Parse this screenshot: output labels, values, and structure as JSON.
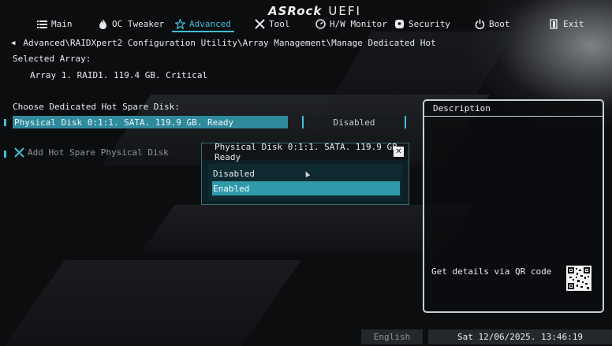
{
  "brand": {
    "logo": "ASRock",
    "product": "UEFI"
  },
  "menu": [
    {
      "label": "Main",
      "icon": "list-icon"
    },
    {
      "label": "OC Tweaker",
      "icon": "flame-icon"
    },
    {
      "label": "Advanced",
      "icon": "star-icon",
      "active": true
    },
    {
      "label": "Tool",
      "icon": "tools-icon"
    },
    {
      "label": "H/W Monitor",
      "icon": "monitor-icon"
    },
    {
      "label": "Security",
      "icon": "shield-icon"
    },
    {
      "label": "Boot",
      "icon": "power-icon"
    },
    {
      "label": "Exit",
      "icon": "exit-icon"
    }
  ],
  "breadcrumb": "Advanced\\RAIDXpert2 Configuration Utility\\Array Management\\Manage Dedicated Hot",
  "selected_array": {
    "label": "Selected Array:",
    "value": "Array 1. RAID1. 119.4 GB. Critical"
  },
  "choose_label": "Choose Dedicated Hot Spare Disk:",
  "disk_row": {
    "label": "Physical Disk 0:1:1. SATA. 119.9 GB. Ready",
    "value": "Disabled"
  },
  "add_hot_spare": "Add Hot Spare Physical Disk",
  "popup": {
    "title": "Physical Disk 0:1:1. SATA. 119.9 GB. Ready",
    "options": [
      "Disabled",
      "Enabled"
    ],
    "selected": "Enabled"
  },
  "description": {
    "title": "Description",
    "qr_text": "Get details via QR code"
  },
  "footer": {
    "language": "English",
    "datetime": "Sat 12/06/2025. 13:46:19"
  },
  "colors": {
    "accent": "#3fc1d6",
    "highlight": "#2f8a9c",
    "background": "#0c0d0f"
  }
}
